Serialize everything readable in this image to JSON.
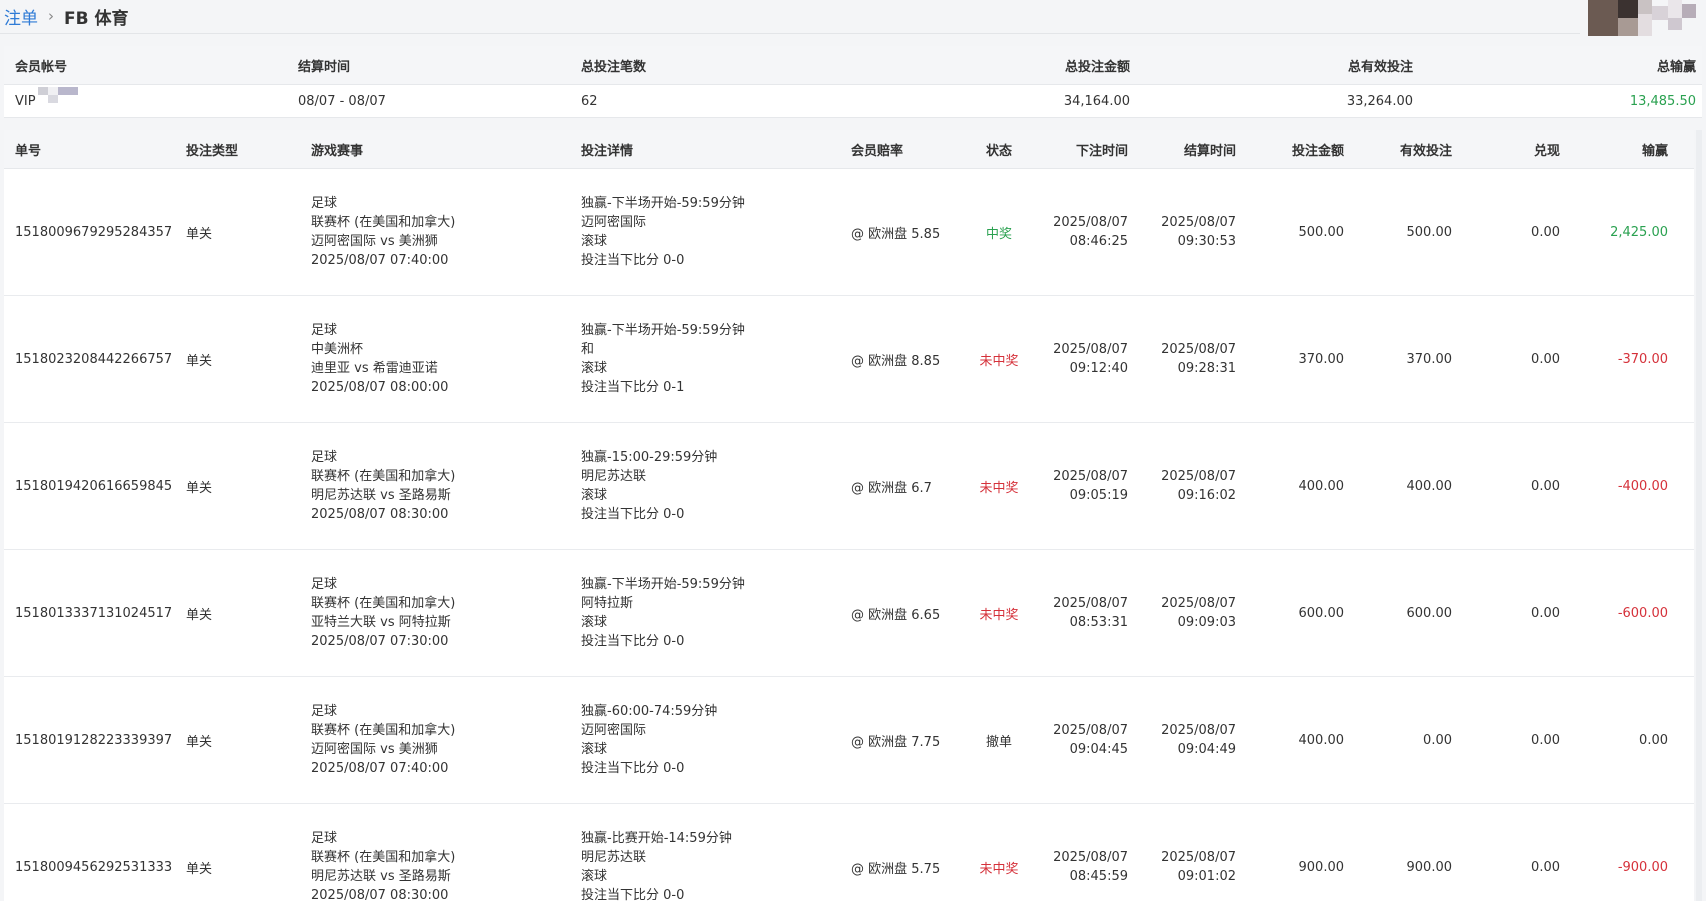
{
  "breadcrumb": {
    "parent": "注单",
    "current": "FB 体育"
  },
  "colors": {
    "link": "#2f7bd6",
    "win": "#2aa150",
    "lose": "#d5313a"
  },
  "summary": {
    "headers": {
      "account": "会员帐号",
      "settle_time": "结算时间",
      "total_count": "总投注笔数",
      "total_amount": "总投注金额",
      "total_valid": "总有效投注",
      "total_winloss": "总输赢"
    },
    "row": {
      "account": "VIP",
      "settle_time": "08/07 - 08/07",
      "total_count": "62",
      "total_amount": "34,164.00",
      "total_valid": "33,264.00",
      "total_winloss": "13,485.50"
    }
  },
  "table": {
    "headers": {
      "id": "单号",
      "type": "投注类型",
      "event": "游戏赛事",
      "detail": "投注详情",
      "odds": "会员赔率",
      "status": "状态",
      "bet_time": "下注时间",
      "settle_time": "结算时间",
      "amount": "投注金额",
      "valid": "有效投注",
      "cashout": "兑现",
      "winloss": "输赢"
    },
    "rows": [
      {
        "id": "1518009679295284357",
        "type": "单关",
        "event": [
          "足球",
          "联赛杯 (在美国和加拿大)",
          "迈阿密国际 vs 美洲狮",
          "2025/08/07 07:40:00"
        ],
        "detail": [
          "独赢-下半场开始-59:59分钟",
          "迈阿密国际",
          "滚球",
          "投注当下比分 0-0"
        ],
        "odds": "@ 欧洲盘 5.85",
        "status": "中奖",
        "status_kind": "win",
        "bet_time": [
          "2025/08/07",
          "08:46:25"
        ],
        "settle_time": [
          "2025/08/07",
          "09:30:53"
        ],
        "amount": "500.00",
        "valid": "500.00",
        "cashout": "0.00",
        "winloss": "2,425.00",
        "winloss_kind": "win"
      },
      {
        "id": "1518023208442266757",
        "type": "单关",
        "event": [
          "足球",
          "中美洲杯",
          "迪里亚 vs 希雷迪亚诺",
          "2025/08/07 08:00:00"
        ],
        "detail": [
          "独赢-下半场开始-59:59分钟",
          "和",
          "滚球",
          "投注当下比分 0-1"
        ],
        "odds": "@ 欧洲盘 8.85",
        "status": "未中奖",
        "status_kind": "lose",
        "bet_time": [
          "2025/08/07",
          "09:12:40"
        ],
        "settle_time": [
          "2025/08/07",
          "09:28:31"
        ],
        "amount": "370.00",
        "valid": "370.00",
        "cashout": "0.00",
        "winloss": "-370.00",
        "winloss_kind": "lose"
      },
      {
        "id": "1518019420616659845",
        "type": "单关",
        "event": [
          "足球",
          "联赛杯 (在美国和加拿大)",
          "明尼苏达联 vs 圣路易斯",
          "2025/08/07 08:30:00"
        ],
        "detail": [
          "独赢-15:00-29:59分钟",
          "明尼苏达联",
          "滚球",
          "投注当下比分 0-0"
        ],
        "odds": "@ 欧洲盘 6.7",
        "status": "未中奖",
        "status_kind": "lose",
        "bet_time": [
          "2025/08/07",
          "09:05:19"
        ],
        "settle_time": [
          "2025/08/07",
          "09:16:02"
        ],
        "amount": "400.00",
        "valid": "400.00",
        "cashout": "0.00",
        "winloss": "-400.00",
        "winloss_kind": "lose"
      },
      {
        "id": "1518013337131024517",
        "type": "单关",
        "event": [
          "足球",
          "联赛杯 (在美国和加拿大)",
          "亚特兰大联 vs 阿特拉斯",
          "2025/08/07 07:30:00"
        ],
        "detail": [
          "独赢-下半场开始-59:59分钟",
          "阿特拉斯",
          "滚球",
          "投注当下比分 0-0"
        ],
        "odds": "@ 欧洲盘 6.65",
        "status": "未中奖",
        "status_kind": "lose",
        "bet_time": [
          "2025/08/07",
          "08:53:31"
        ],
        "settle_time": [
          "2025/08/07",
          "09:09:03"
        ],
        "amount": "600.00",
        "valid": "600.00",
        "cashout": "0.00",
        "winloss": "-600.00",
        "winloss_kind": "lose"
      },
      {
        "id": "1518019128223339397",
        "type": "单关",
        "event": [
          "足球",
          "联赛杯 (在美国和加拿大)",
          "迈阿密国际 vs 美洲狮",
          "2025/08/07 07:40:00"
        ],
        "detail": [
          "独赢-60:00-74:59分钟",
          "迈阿密国际",
          "滚球",
          "投注当下比分 0-0"
        ],
        "odds": "@ 欧洲盘 7.75",
        "status": "撤单",
        "status_kind": "neutral",
        "bet_time": [
          "2025/08/07",
          "09:04:45"
        ],
        "settle_time": [
          "2025/08/07",
          "09:04:49"
        ],
        "amount": "400.00",
        "valid": "0.00",
        "cashout": "0.00",
        "winloss": "0.00",
        "winloss_kind": "neutral"
      },
      {
        "id": "1518009456292531333",
        "type": "单关",
        "event": [
          "足球",
          "联赛杯 (在美国和加拿大)",
          "明尼苏达联 vs 圣路易斯",
          "2025/08/07 08:30:00"
        ],
        "detail": [
          "独赢-比赛开始-14:59分钟",
          "明尼苏达联",
          "滚球",
          "投注当下比分 0-0"
        ],
        "odds": "@ 欧洲盘 5.75",
        "status": "未中奖",
        "status_kind": "lose",
        "bet_time": [
          "2025/08/07",
          "08:45:59"
        ],
        "settle_time": [
          "2025/08/07",
          "09:01:02"
        ],
        "amount": "900.00",
        "valid": "900.00",
        "cashout": "0.00",
        "winloss": "-900.00",
        "winloss_kind": "lose"
      }
    ]
  }
}
